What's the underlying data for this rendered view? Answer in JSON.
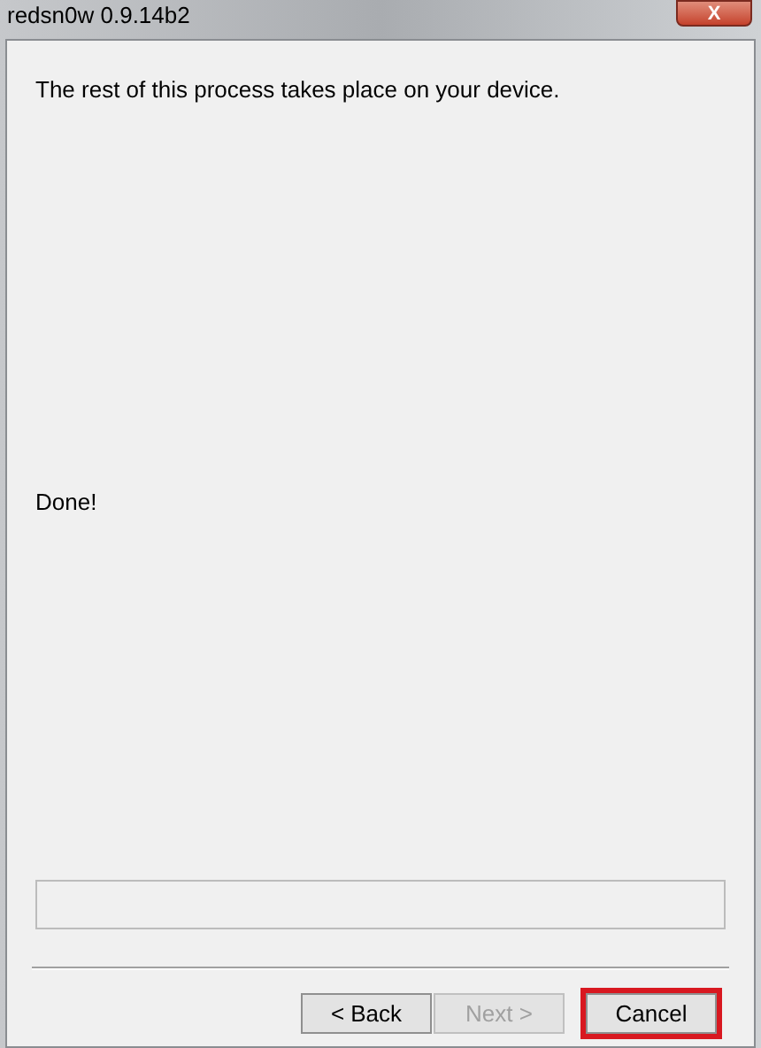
{
  "window": {
    "title": "redsn0w 0.9.14b2",
    "close": "X"
  },
  "message": "The rest of this process takes place on your device.",
  "status": "Done!",
  "buttons": [
    {
      "label": "< Back",
      "disabled": false,
      "highlighted": false
    },
    {
      "label": "Next >",
      "disabled": true,
      "highlighted": false
    },
    {
      "label": "Cancel",
      "disabled": false,
      "highlighted": true
    }
  ]
}
